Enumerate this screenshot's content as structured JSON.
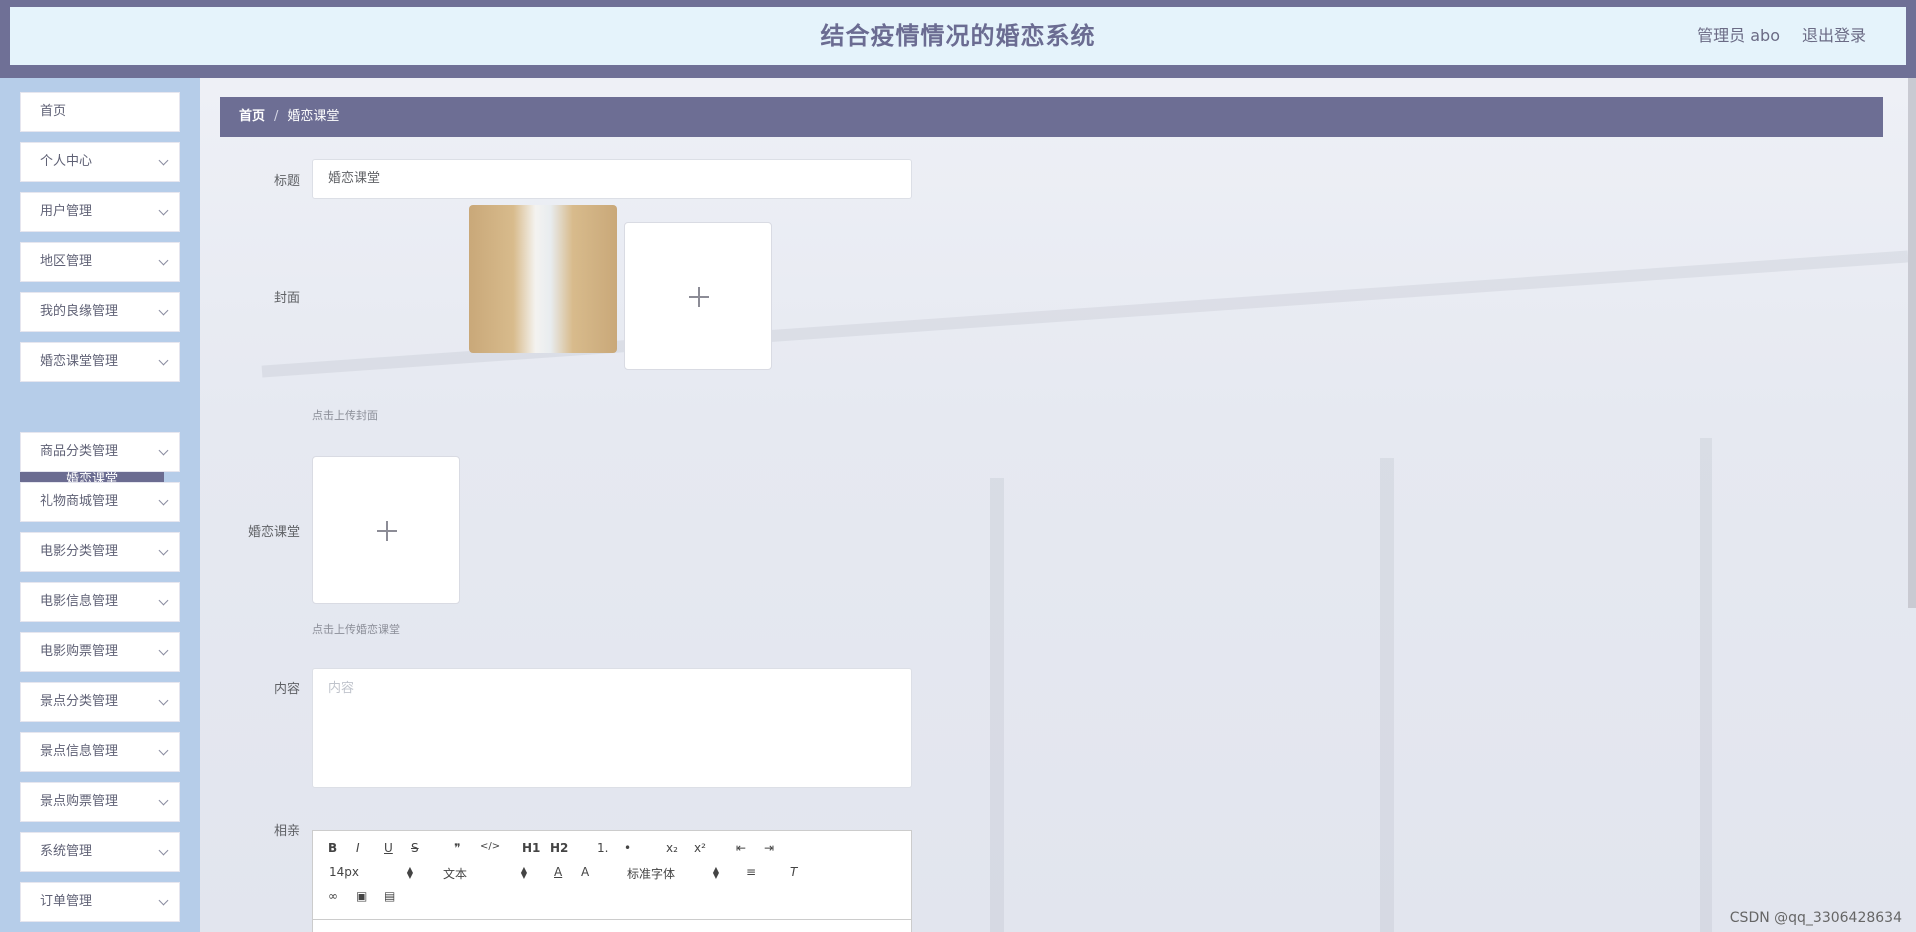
{
  "header": {
    "title": "结合疫情情况的婚恋系统",
    "admin": "管理员 abo",
    "logout": "退出登录"
  },
  "sidebar": {
    "items": [
      {
        "label": "首页",
        "has_children": false
      },
      {
        "label": "个人中心",
        "has_children": true
      },
      {
        "label": "用户管理",
        "has_children": true
      },
      {
        "label": "地区管理",
        "has_children": true
      },
      {
        "label": "我的良缘管理",
        "has_children": true
      },
      {
        "label": "婚恋课堂管理",
        "has_children": true
      },
      {
        "label": "商品分类管理",
        "has_children": true
      },
      {
        "label": "礼物商城管理",
        "has_children": true
      },
      {
        "label": "电影分类管理",
        "has_children": true
      },
      {
        "label": "电影信息管理",
        "has_children": true
      },
      {
        "label": "电影购票管理",
        "has_children": true
      },
      {
        "label": "景点分类管理",
        "has_children": true
      },
      {
        "label": "景点信息管理",
        "has_children": true
      },
      {
        "label": "景点购票管理",
        "has_children": true
      },
      {
        "label": "系统管理",
        "has_children": true
      },
      {
        "label": "订单管理",
        "has_children": true
      }
    ],
    "active_sub": "婚恋课堂"
  },
  "breadcrumb": {
    "home": "首页",
    "separator": "/",
    "current": "婚恋课堂"
  },
  "form": {
    "title_label": "标题",
    "title_value": "婚恋课堂",
    "cover_label": "封面",
    "cover_hint": "点击上传封面",
    "course_label": "婚恋课堂",
    "course_hint": "点击上传婚恋课堂",
    "content_label": "内容",
    "content_placeholder": "内容",
    "xiangqin_label": "相亲"
  },
  "editor": {
    "row1": [
      "B",
      "I",
      "U",
      "S",
      "❞",
      "</>",
      "H1",
      "H2",
      "1.",
      "•",
      "x₂",
      "x²",
      "⇤",
      "⇥"
    ],
    "font_size": "14px",
    "header_select": "文本",
    "font_family": "标准字体"
  },
  "watermark": "CSDN @qq_3306428634",
  "colors": {
    "accent": "#6d6e94",
    "header_bg": "#e5f3fb",
    "sidebar_bg": "#b6cde9"
  }
}
